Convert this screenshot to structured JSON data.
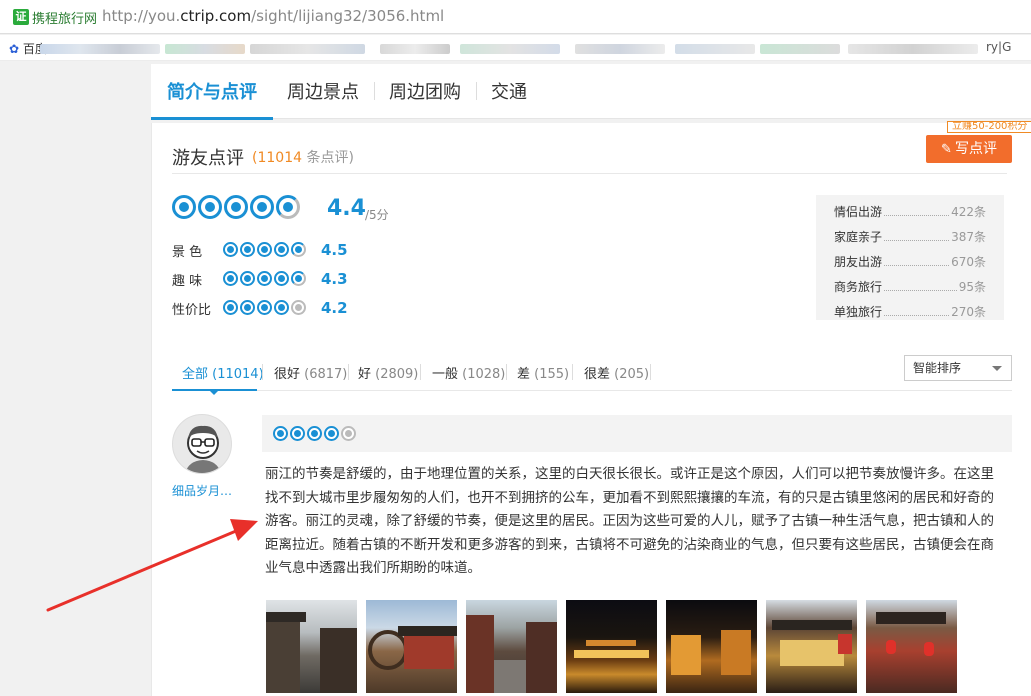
{
  "browser": {
    "site_name": "携程旅行网",
    "favicon": "证",
    "url_host_prefix": "http://you.",
    "url_host_bold": "ctrip.com",
    "url_path": "/sight/lijiang32/3056.html",
    "bookmark_label": "百度",
    "bookmark_tail": "ry|G"
  },
  "tabs": [
    {
      "label": "简介与点评",
      "active": true
    },
    {
      "label": "周边景点",
      "active": false
    },
    {
      "label": "周边团购",
      "active": false
    },
    {
      "label": "交通",
      "active": false
    }
  ],
  "reviews_header": {
    "title": "游友点评",
    "count_open": "(",
    "count": "11014",
    "count_unit": "条点评)",
    "badge": "立赚50-200积分",
    "write_button": "写点评"
  },
  "overall": {
    "score": "4.4",
    "unit": "/5分",
    "circles": 4.5
  },
  "sub_scores": [
    {
      "label": "景  色",
      "score": "4.5",
      "circles": 4.5
    },
    {
      "label": "趣  味",
      "score": "4.3",
      "circles": 4.5
    },
    {
      "label": "性价比",
      "score": "4.2",
      "circles": 4
    }
  ],
  "traveler_types": [
    {
      "label": "情侣出游",
      "count": "422条"
    },
    {
      "label": "家庭亲子",
      "count": "387条"
    },
    {
      "label": "朋友出游",
      "count": "670条"
    },
    {
      "label": "商务旅行",
      "count": "95条"
    },
    {
      "label": "单独旅行",
      "count": "270条"
    }
  ],
  "filters": [
    {
      "label": "全部",
      "count": "(11014)",
      "active": true
    },
    {
      "label": "很好",
      "count": "(6817)",
      "active": false
    },
    {
      "label": "好",
      "count": "(2809)",
      "active": false
    },
    {
      "label": "一般",
      "count": "(1028)",
      "active": false
    },
    {
      "label": "差",
      "count": "(155)",
      "active": false
    },
    {
      "label": "很差",
      "count": "(205)",
      "active": false
    }
  ],
  "sort": {
    "selected": "智能排序"
  },
  "review": {
    "user_name": "细品岁月…",
    "rating": 4,
    "text": "丽江的节奏是舒缓的，由于地理位置的关系，这里的白天很长很长。或许正是这个原因，人们可以把节奏放慢许多。在这里找不到大城市里步履匆匆的人们，也开不到拥挤的公车，更加看不到熙熙攘攘的车流，有的只是古镇里悠闲的居民和好奇的游客。丽江的灵魂，除了舒缓的节奏，便是这里的居民。正因为这些可爱的人儿，赋予了古镇一种生活气息，把古镇和人的距离拉近。随着古镇的不断开发和更多游客的到来，古镇将不可避免的沾染商业的气息，但只要有这些居民，古镇便会在商业气息中透露出我们所期盼的味道。",
    "photo_count": 7
  },
  "colors": {
    "accent": "#1a90d4",
    "orange": "#f26d2c",
    "count_orange": "#f08a24",
    "arrow": "#e8302a"
  }
}
